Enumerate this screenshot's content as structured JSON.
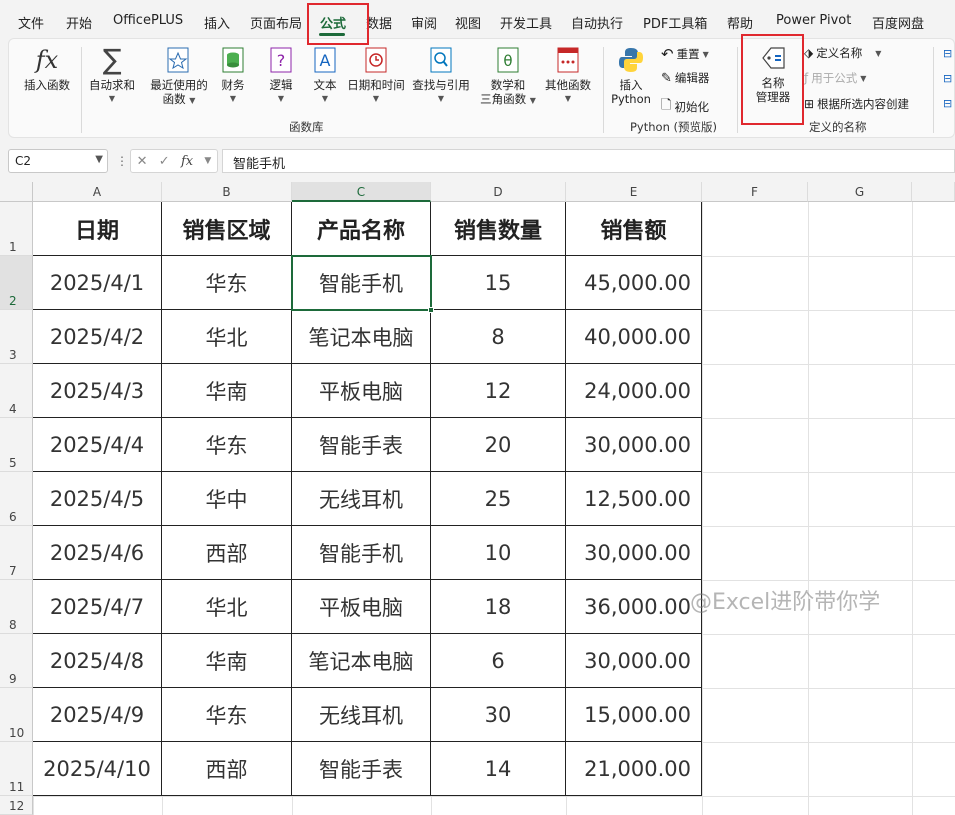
{
  "menu_tabs": [
    "文件",
    "开始",
    "OfficePLUS",
    "插入",
    "页面布局",
    "公式",
    "数据",
    "审阅",
    "视图",
    "开发工具",
    "自动执行",
    "PDF工具箱",
    "帮助",
    "Power Pivot",
    "百度网盘"
  ],
  "active_tab": "公式",
  "ribbon": {
    "insert_function": "插入函数",
    "autosum": "自动求和",
    "recent": [
      "最近使用的",
      "函数"
    ],
    "financial": "财务",
    "logical": "逻辑",
    "text": "文本",
    "datetime": "日期和时间",
    "lookup": "查找与引用",
    "math": [
      "数学和",
      "三角函数"
    ],
    "other": "其他函数",
    "group_library": "函数库",
    "insert_python": [
      "插入",
      "Python"
    ],
    "reset": "重置",
    "editor": "编辑器",
    "initialize": "初始化",
    "group_python": "Python (预览版)",
    "name_manager": [
      "名称",
      "管理器"
    ],
    "define_name": "定义名称",
    "use_in_formula": "用于公式",
    "create_from_selection": "根据所选内容创建",
    "group_defined_names": "定义的名称"
  },
  "formula_bar": {
    "name_box": "C2",
    "content": "智能手机"
  },
  "columns": [
    "A",
    "B",
    "C",
    "D",
    "E",
    "F",
    "G"
  ],
  "rows": [
    "1",
    "2",
    "3",
    "4",
    "5",
    "6",
    "7",
    "8",
    "9",
    "10",
    "11",
    "12"
  ],
  "table": {
    "headers": [
      "日期",
      "销售区域",
      "产品名称",
      "销售数量",
      "销售额"
    ],
    "rows": [
      [
        "2025/4/1",
        "华东",
        "智能手机",
        "15",
        "45,000.00"
      ],
      [
        "2025/4/2",
        "华北",
        "笔记本电脑",
        "8",
        "40,000.00"
      ],
      [
        "2025/4/3",
        "华南",
        "平板电脑",
        "12",
        "24,000.00"
      ],
      [
        "2025/4/4",
        "华东",
        "智能手表",
        "20",
        "30,000.00"
      ],
      [
        "2025/4/5",
        "华中",
        "无线耳机",
        "25",
        "12,500.00"
      ],
      [
        "2025/4/6",
        "西部",
        "智能手机",
        "10",
        "30,000.00"
      ],
      [
        "2025/4/7",
        "华北",
        "平板电脑",
        "18",
        "36,000.00"
      ],
      [
        "2025/4/8",
        "华南",
        "笔记本电脑",
        "6",
        "30,000.00"
      ],
      [
        "2025/4/9",
        "华东",
        "无线耳机",
        "30",
        "15,000.00"
      ],
      [
        "2025/4/10",
        "西部",
        "智能手表",
        "14",
        "21,000.00"
      ]
    ]
  },
  "watermark": "@Excel进阶带你学",
  "colors": {
    "accent_green": "#1d6a3a",
    "highlight_red": "#e0282e"
  }
}
